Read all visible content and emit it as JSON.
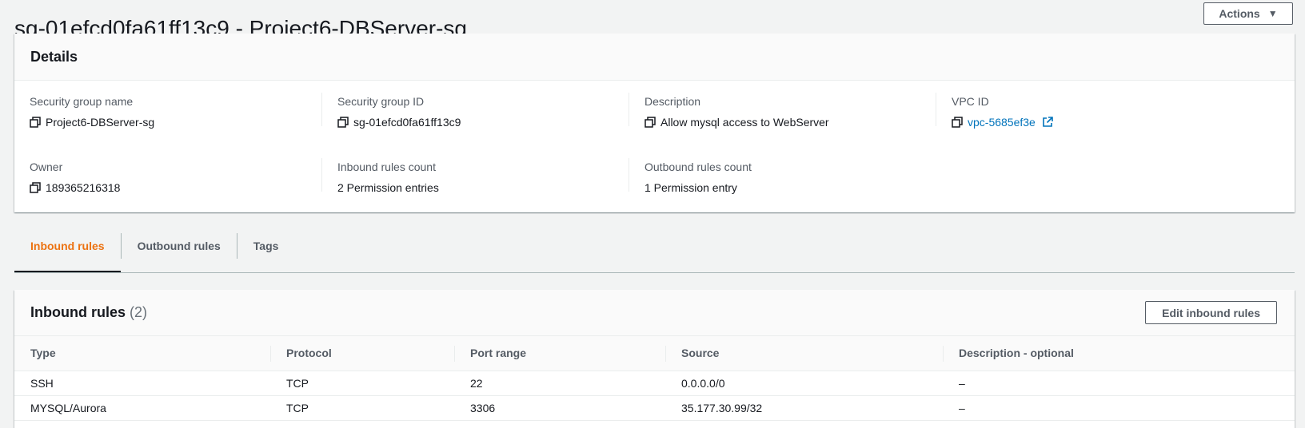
{
  "header": {
    "title": "sg-01efcd0fa61ff13c9 - Project6-DBServer-sg",
    "actions_label": "Actions",
    "actions_caret": "▼"
  },
  "details": {
    "title": "Details",
    "fields": [
      {
        "label": "Security group name",
        "value": "Project6-DBServer-sg",
        "copy": true,
        "link": false
      },
      {
        "label": "Security group ID",
        "value": "sg-01efcd0fa61ff13c9",
        "copy": true,
        "link": false
      },
      {
        "label": "Description",
        "value": "Allow mysql access to WebServer",
        "copy": true,
        "link": false
      },
      {
        "label": "VPC ID",
        "value": "vpc-5685ef3e",
        "copy": true,
        "link": true
      },
      {
        "label": "Owner",
        "value": "189365216318",
        "copy": true,
        "link": false
      },
      {
        "label": "Inbound rules count",
        "value": "2 Permission entries",
        "copy": false,
        "link": false
      },
      {
        "label": "Outbound rules count",
        "value": "1 Permission entry",
        "copy": false,
        "link": false
      }
    ]
  },
  "tabs": [
    {
      "label": "Inbound rules",
      "active": true
    },
    {
      "label": "Outbound rules",
      "active": false
    },
    {
      "label": "Tags",
      "active": false
    }
  ],
  "inbound": {
    "title": "Inbound rules",
    "count": "(2)",
    "edit_label": "Edit inbound rules",
    "columns": [
      "Type",
      "Protocol",
      "Port range",
      "Source",
      "Description - optional"
    ],
    "rows": [
      [
        "SSH",
        "TCP",
        "22",
        "0.0.0.0/0",
        "–"
      ],
      [
        "MYSQL/Aurora",
        "TCP",
        "3306",
        "35.177.30.99/32",
        "–"
      ]
    ]
  },
  "colors": {
    "accent_orange": "#ec7211",
    "link_blue": "#0073bb",
    "text": "#16191f",
    "muted": "#545b64"
  },
  "icons": {
    "copy": "copy-icon",
    "external_link": "external-link-icon",
    "caret": "caret-down-icon"
  }
}
